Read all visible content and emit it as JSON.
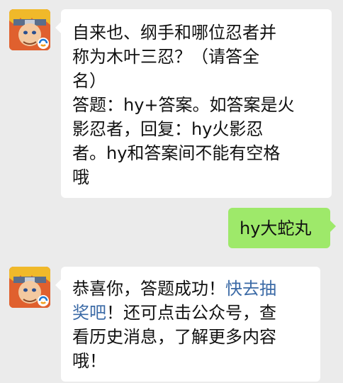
{
  "messages": [
    {
      "sender": "official-account",
      "direction": "incoming",
      "lines": [
        "自来也、纲手和哪位忍者并",
        "称为木叶三忍？（请答全",
        "名）",
        "答题：hy+答案。如答案是火",
        "影忍者，回复：hy火影忍",
        "者。hy和答案间不能有空格",
        "哦"
      ]
    },
    {
      "sender": "user",
      "direction": "outgoing",
      "text": "hy大蛇丸"
    },
    {
      "sender": "official-account",
      "direction": "incoming",
      "line1_prefix": "恭喜你，答题成功！",
      "line1_link": "快去抽",
      "line2_link": "奖吧",
      "line2_rest": "！还可点击公众号，查",
      "line3": "看历史消息，了解更多内容",
      "line4": "哦！"
    }
  ],
  "colors": {
    "background": "#ebebeb",
    "incoming_bubble": "#ffffff",
    "outgoing_bubble": "#9ee96a",
    "link": "#3b6aa6"
  },
  "icons": [
    "naruto-avatar-icon",
    "game-badge-icon"
  ]
}
